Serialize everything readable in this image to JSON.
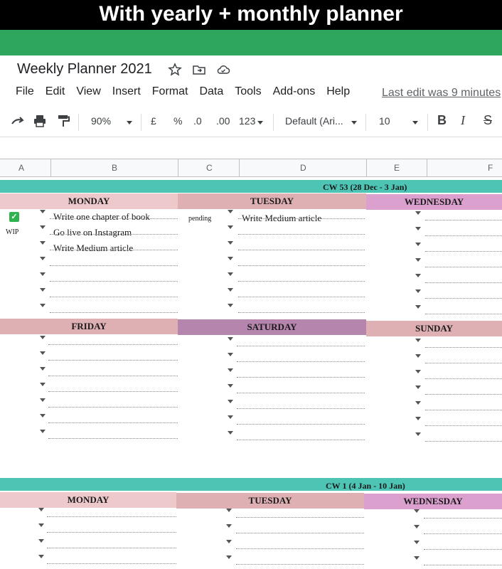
{
  "banner": {
    "text": "With yearly + monthly planner"
  },
  "doc": {
    "title": "Weekly Planner 2021"
  },
  "menu": [
    "File",
    "Edit",
    "View",
    "Insert",
    "Format",
    "Data",
    "Tools",
    "Add-ons",
    "Help"
  ],
  "last_edit": "Last edit was 9 minutes",
  "toolbar": {
    "zoom": "90%",
    "currency": "£",
    "percent": "%",
    "dec_less": ".0",
    "dec_more": ".00",
    "number_format": "123",
    "font": "Default (Ari...",
    "font_size": "10",
    "bold": "B",
    "italic": "I",
    "strike": "S"
  },
  "columns": [
    "A",
    "B",
    "C",
    "D",
    "E",
    "F"
  ],
  "weeks": [
    {
      "label": "CW 53 (28 Dec - 3 Jan)"
    },
    {
      "label": "CW 1 (4 Jan - 10 Jan)"
    }
  ],
  "days": {
    "mon": "MONDAY",
    "tue": "TUESDAY",
    "wed": "WEDNESDAY",
    "fri": "FRIDAY",
    "sat": "SATURDAY",
    "sun": "SUNDAY"
  },
  "tasks": {
    "mon": [
      "Write one chapter of book",
      "Go live on Instagram",
      "Write Medium article"
    ],
    "tue": [
      "Write Medium article"
    ]
  },
  "statuses": {
    "mon_2": "WIP",
    "tue_1": "pending"
  },
  "colors": {
    "teal": "#4dc4b4",
    "pink_light": "#eec9cc",
    "pink_mid": "#dfb0b3",
    "purple": "#b685ad",
    "magenta": "#dba0ce",
    "green": "#2ea65e"
  }
}
